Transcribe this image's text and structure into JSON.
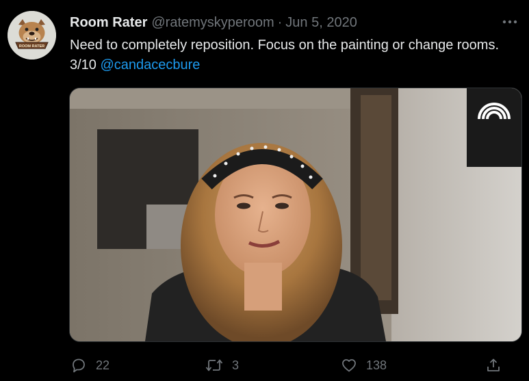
{
  "tweet": {
    "display_name": "Room Rater",
    "handle": "@ratemyskyperoom",
    "separator": "·",
    "date": "Jun 5, 2020",
    "text": "Need to completely reposition. Focus on the painting or change rooms. 3/10 ",
    "mention": "@candacecbure",
    "avatar_badge_text": "ROOM RATER",
    "more_icon": "more-horizontal-icon",
    "media_logo_icon": "broadcaster-rainbow-logo-icon"
  },
  "actions": {
    "reply": {
      "icon": "reply-bubble-icon",
      "count": "22"
    },
    "retweet": {
      "icon": "retweet-arrows-icon",
      "count": "3"
    },
    "like": {
      "icon": "heart-icon",
      "count": "138"
    },
    "share": {
      "icon": "share-upload-icon"
    }
  },
  "colors": {
    "background": "#000000",
    "primary_text": "#e7e9ea",
    "secondary_text": "#71767b",
    "link": "#1d9bf0"
  }
}
